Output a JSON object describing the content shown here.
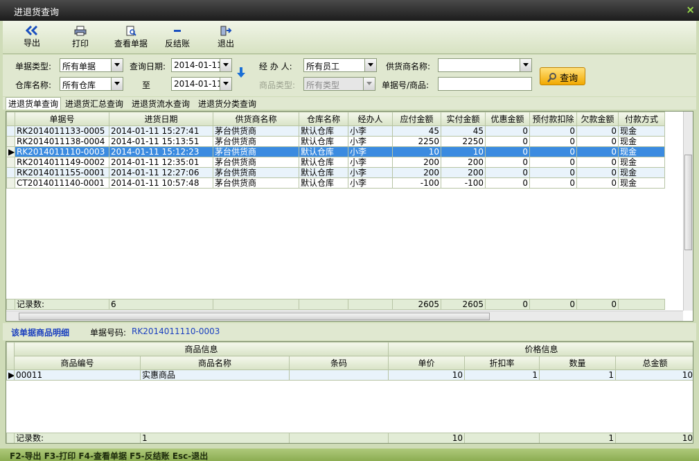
{
  "window": {
    "title": "进退货查询",
    "close_glyph": "×"
  },
  "toolbar": {
    "export": "导出",
    "print": "打印",
    "view_doc": "查看单据",
    "reverse": "反结账",
    "exit": "退出"
  },
  "filter": {
    "doc_type_label": "单据类型:",
    "doc_type_value": "所有单据",
    "date_label": "查询日期:",
    "date_from": "2014-01-11",
    "to_label": "至",
    "date_to": "2014-01-11",
    "handler_label": "经 办 人:",
    "handler_value": "所有员工",
    "supplier_label": "供货商名称:",
    "supplier_value": "",
    "warehouse_label": "仓库名称:",
    "warehouse_value": "所有仓库",
    "category_label": "商品类型:",
    "category_value": "所有类型",
    "docno_label": "单据号/商品:",
    "docno_value": "",
    "search_button": "查询"
  },
  "tabs": [
    "进退货单查询",
    "进退货汇总查询",
    "进退货流水查询",
    "进退货分类查询"
  ],
  "main_grid": {
    "columns": [
      "单据号",
      "进货日期",
      "供货商名称",
      "仓库名称",
      "经办人",
      "应付金额",
      "实付金额",
      "优惠金额",
      "预付款扣除",
      "欠款金额",
      "付款方式"
    ],
    "rows": [
      [
        "RK2014011133-0005",
        "2014-01-11 15:27:41",
        "茅台供货商",
        "默认仓库",
        "小李",
        "45",
        "45",
        "0",
        "0",
        "0",
        "现金"
      ],
      [
        "RK2014011138-0004",
        "2014-01-11 15:13:51",
        "茅台供货商",
        "默认仓库",
        "小李",
        "2250",
        "2250",
        "0",
        "0",
        "0",
        "现金"
      ],
      [
        "RK2014011110-0003",
        "2014-01-11 15:12:23",
        "茅台供货商",
        "默认仓库",
        "小李",
        "10",
        "10",
        "0",
        "0",
        "0",
        "现金"
      ],
      [
        "RK2014011149-0002",
        "2014-01-11 12:35:01",
        "茅台供货商",
        "默认仓库",
        "小李",
        "200",
        "200",
        "0",
        "0",
        "0",
        "现金"
      ],
      [
        "RK2014011155-0001",
        "2014-01-11 12:27:06",
        "茅台供货商",
        "默认仓库",
        "小李",
        "200",
        "200",
        "0",
        "0",
        "0",
        "现金"
      ],
      [
        "CT2014011140-0001",
        "2014-01-11 10:57:48",
        "茅台供货商",
        "默认仓库",
        "小李",
        "-100",
        "-100",
        "0",
        "0",
        "0",
        "现金"
      ]
    ],
    "selected_row": 2,
    "footer": [
      "记录数:",
      "6",
      "",
      "",
      "",
      "2605",
      "2605",
      "0",
      "0",
      "0",
      ""
    ]
  },
  "detail": {
    "title": "该单据商品明细",
    "docno_label": "单据号码:",
    "docno_value": "RK2014011110-0003",
    "group_headers": [
      "商品信息",
      "价格信息"
    ],
    "columns": [
      "商品编号",
      "商品名称",
      "条码",
      "单价",
      "折扣率",
      "数量",
      "总金额"
    ],
    "rows": [
      [
        "00011",
        "实惠商品",
        "",
        "10",
        "1",
        "1",
        "10"
      ]
    ],
    "footer": [
      "记录数:",
      "1",
      "",
      "10",
      "",
      "1",
      "10"
    ]
  },
  "status": "F2-导出 F3-打印 F4-查看单据 F5-反结账 Esc-退出",
  "colors": {
    "accent": "#3b8be0",
    "search_button": "#f2a900"
  }
}
